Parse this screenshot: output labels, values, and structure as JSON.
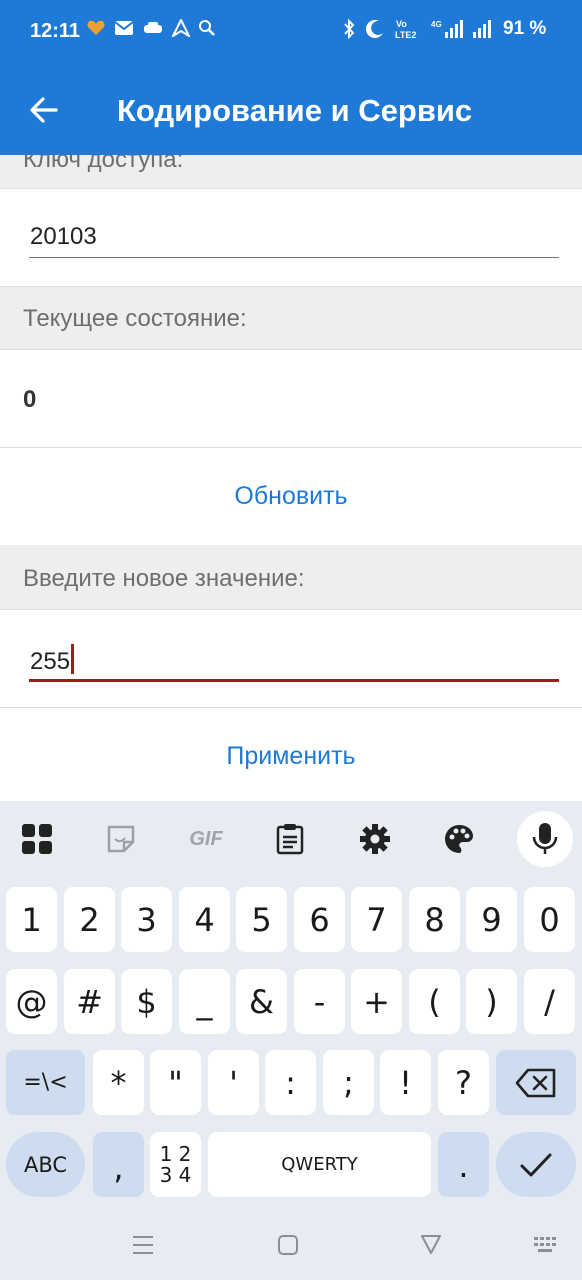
{
  "status_bar": {
    "time": "12:11",
    "battery": "91 %"
  },
  "app_bar": {
    "title": "Кодирование и Сервис"
  },
  "access_key": {
    "label": "Ключ доступа:",
    "value": "20103"
  },
  "current_state": {
    "label": "Текущее состояние:",
    "value": "0",
    "refresh_label": "Обновить"
  },
  "new_value": {
    "label": "Введите новое значение:",
    "value": "255",
    "apply_label": "Применить"
  },
  "keyboard": {
    "toolbar": [
      "apps-grid-icon",
      "sticker-icon",
      "gif-icon",
      "clipboard-icon",
      "settings-icon",
      "palette-icon",
      "mic-icon"
    ],
    "gif_label": "GIF",
    "row1": [
      "1",
      "2",
      "3",
      "4",
      "5",
      "6",
      "7",
      "8",
      "9",
      "0"
    ],
    "row2": [
      "@",
      "#",
      "$",
      "_",
      "&",
      "-",
      "+",
      "(",
      ")",
      "/"
    ],
    "row3": [
      "=\\<",
      "*",
      "\"",
      "'",
      ":",
      ";",
      "!",
      "?"
    ],
    "abc_label": "ABC",
    "comma_label": ",",
    "numpad_label_top": "1 2",
    "numpad_label_bottom": "3 4",
    "space_label": "QWERTY",
    "period_label": "."
  },
  "colors": {
    "app_bar": "#1e7ad6",
    "action_text": "#1e7ad6",
    "active_underline": "#a01818",
    "keyboard_bg": "#e7ecf3"
  }
}
